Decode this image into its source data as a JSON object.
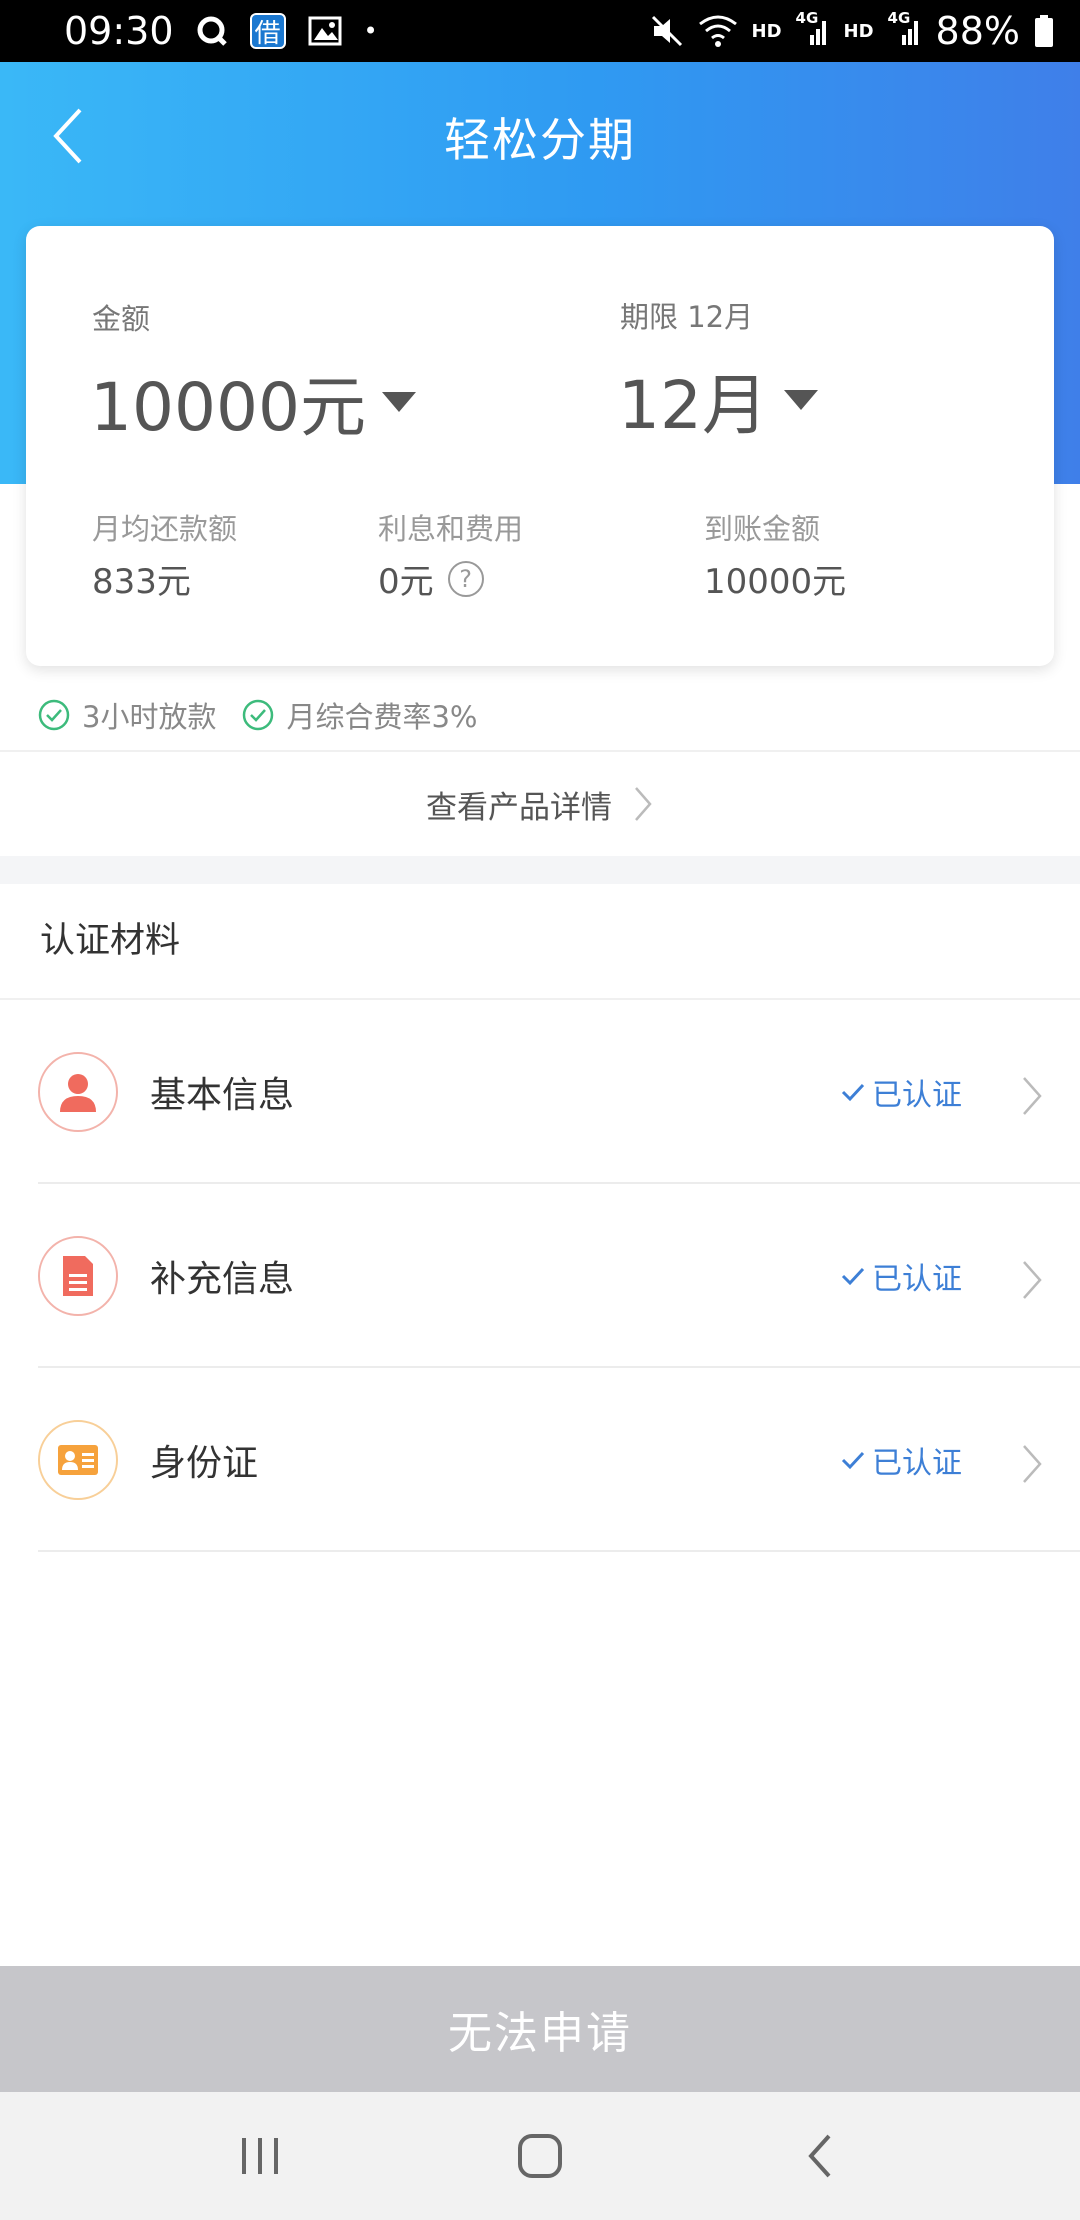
{
  "status_bar": {
    "time": "09:30",
    "app_badge": "借",
    "dot": "•",
    "net_hd_1": "HD",
    "net_4g_1": "4G",
    "net_hd_2": "HD",
    "net_4g_2": "4G",
    "battery": "88%"
  },
  "header": {
    "title": "轻松分期"
  },
  "loan": {
    "amount_label": "金额",
    "amount_value": "10000元",
    "term_label": "期限 12月",
    "term_value": "12月",
    "monthly_label": "月均还款额",
    "monthly_value": "833元",
    "interest_label": "利息和费用",
    "interest_value": "0元",
    "interest_help": "?",
    "received_label": "到账金额",
    "received_value": "10000元"
  },
  "features": [
    {
      "label": "3小时放款"
    },
    {
      "label": "月综合费率3%"
    }
  ],
  "detail_link": {
    "label": "查看产品详情"
  },
  "certification": {
    "title": "认证材料",
    "items": [
      {
        "label": "基本信息",
        "status": "已认证",
        "icon": "person-icon",
        "color": "#f06b5e"
      },
      {
        "label": "补充信息",
        "status": "已认证",
        "icon": "document-icon",
        "color": "#f06b5e"
      },
      {
        "label": "身份证",
        "status": "已认证",
        "icon": "id-card-icon",
        "color": "#f6a23c"
      }
    ]
  },
  "apply_button": {
    "label": "无法申请"
  },
  "colors": {
    "header_gradient_start": "#3ab8f7",
    "header_gradient_end": "#3f7fe9",
    "verified": "#3d7fd6",
    "check_green": "#3dbb7c",
    "button_disabled": "#c6c6ca"
  }
}
